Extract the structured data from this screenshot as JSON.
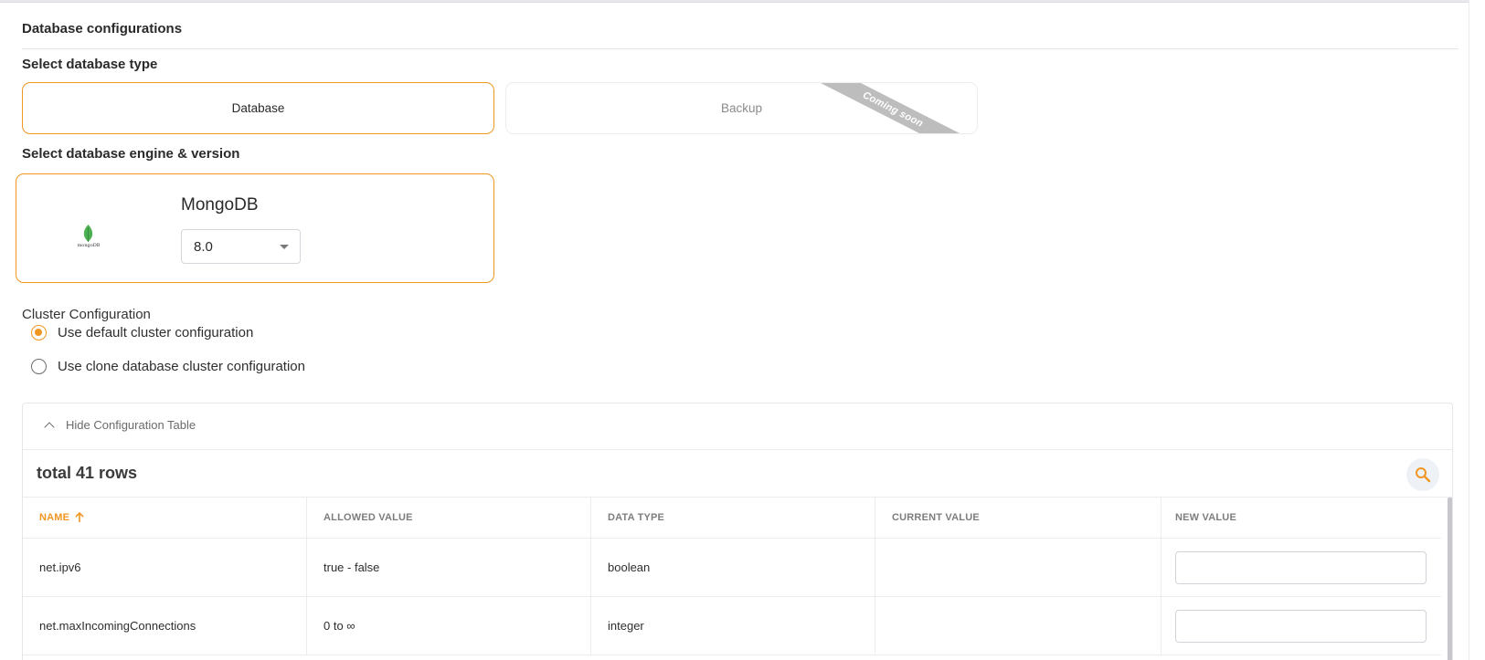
{
  "section": {
    "title": "Database configurations"
  },
  "db_type": {
    "label": "Select database type",
    "options": [
      {
        "label": "Database",
        "selected": true
      },
      {
        "label": "Backup",
        "badge": "Coming soon",
        "disabled": true
      }
    ]
  },
  "engine": {
    "label": "Select database engine & version",
    "name": "MongoDB",
    "logo_text": "mongoDB",
    "version": "8.0"
  },
  "cluster": {
    "label": "Cluster Configuration",
    "options": [
      {
        "label": "Use default cluster configuration",
        "checked": true
      },
      {
        "label": "Use clone database cluster configuration",
        "checked": false
      }
    ]
  },
  "config_table": {
    "toggle_label": "Hide Configuration Table",
    "total_rows": "total 41 rows",
    "columns": [
      "NAME",
      "ALLOWED VALUE",
      "DATA TYPE",
      "CURRENT VALUE",
      "NEW VALUE"
    ],
    "sorted_column": "NAME",
    "rows": [
      {
        "name": "net.ipv6",
        "allowed": "true - false",
        "type": "boolean",
        "current": "",
        "new_value": ""
      },
      {
        "name": "net.maxIncomingConnections",
        "allowed": "0 to ∞",
        "type": "integer",
        "current": "",
        "new_value": ""
      }
    ]
  },
  "colors": {
    "accent": "#f09622",
    "ribbon": "#bdbdbd",
    "leaf": "#4caf50"
  },
  "icons": [
    "mongodb-leaf-icon",
    "chevron-up-icon",
    "search-icon",
    "sort-arrow-up-icon",
    "dropdown-caret-icon"
  ]
}
